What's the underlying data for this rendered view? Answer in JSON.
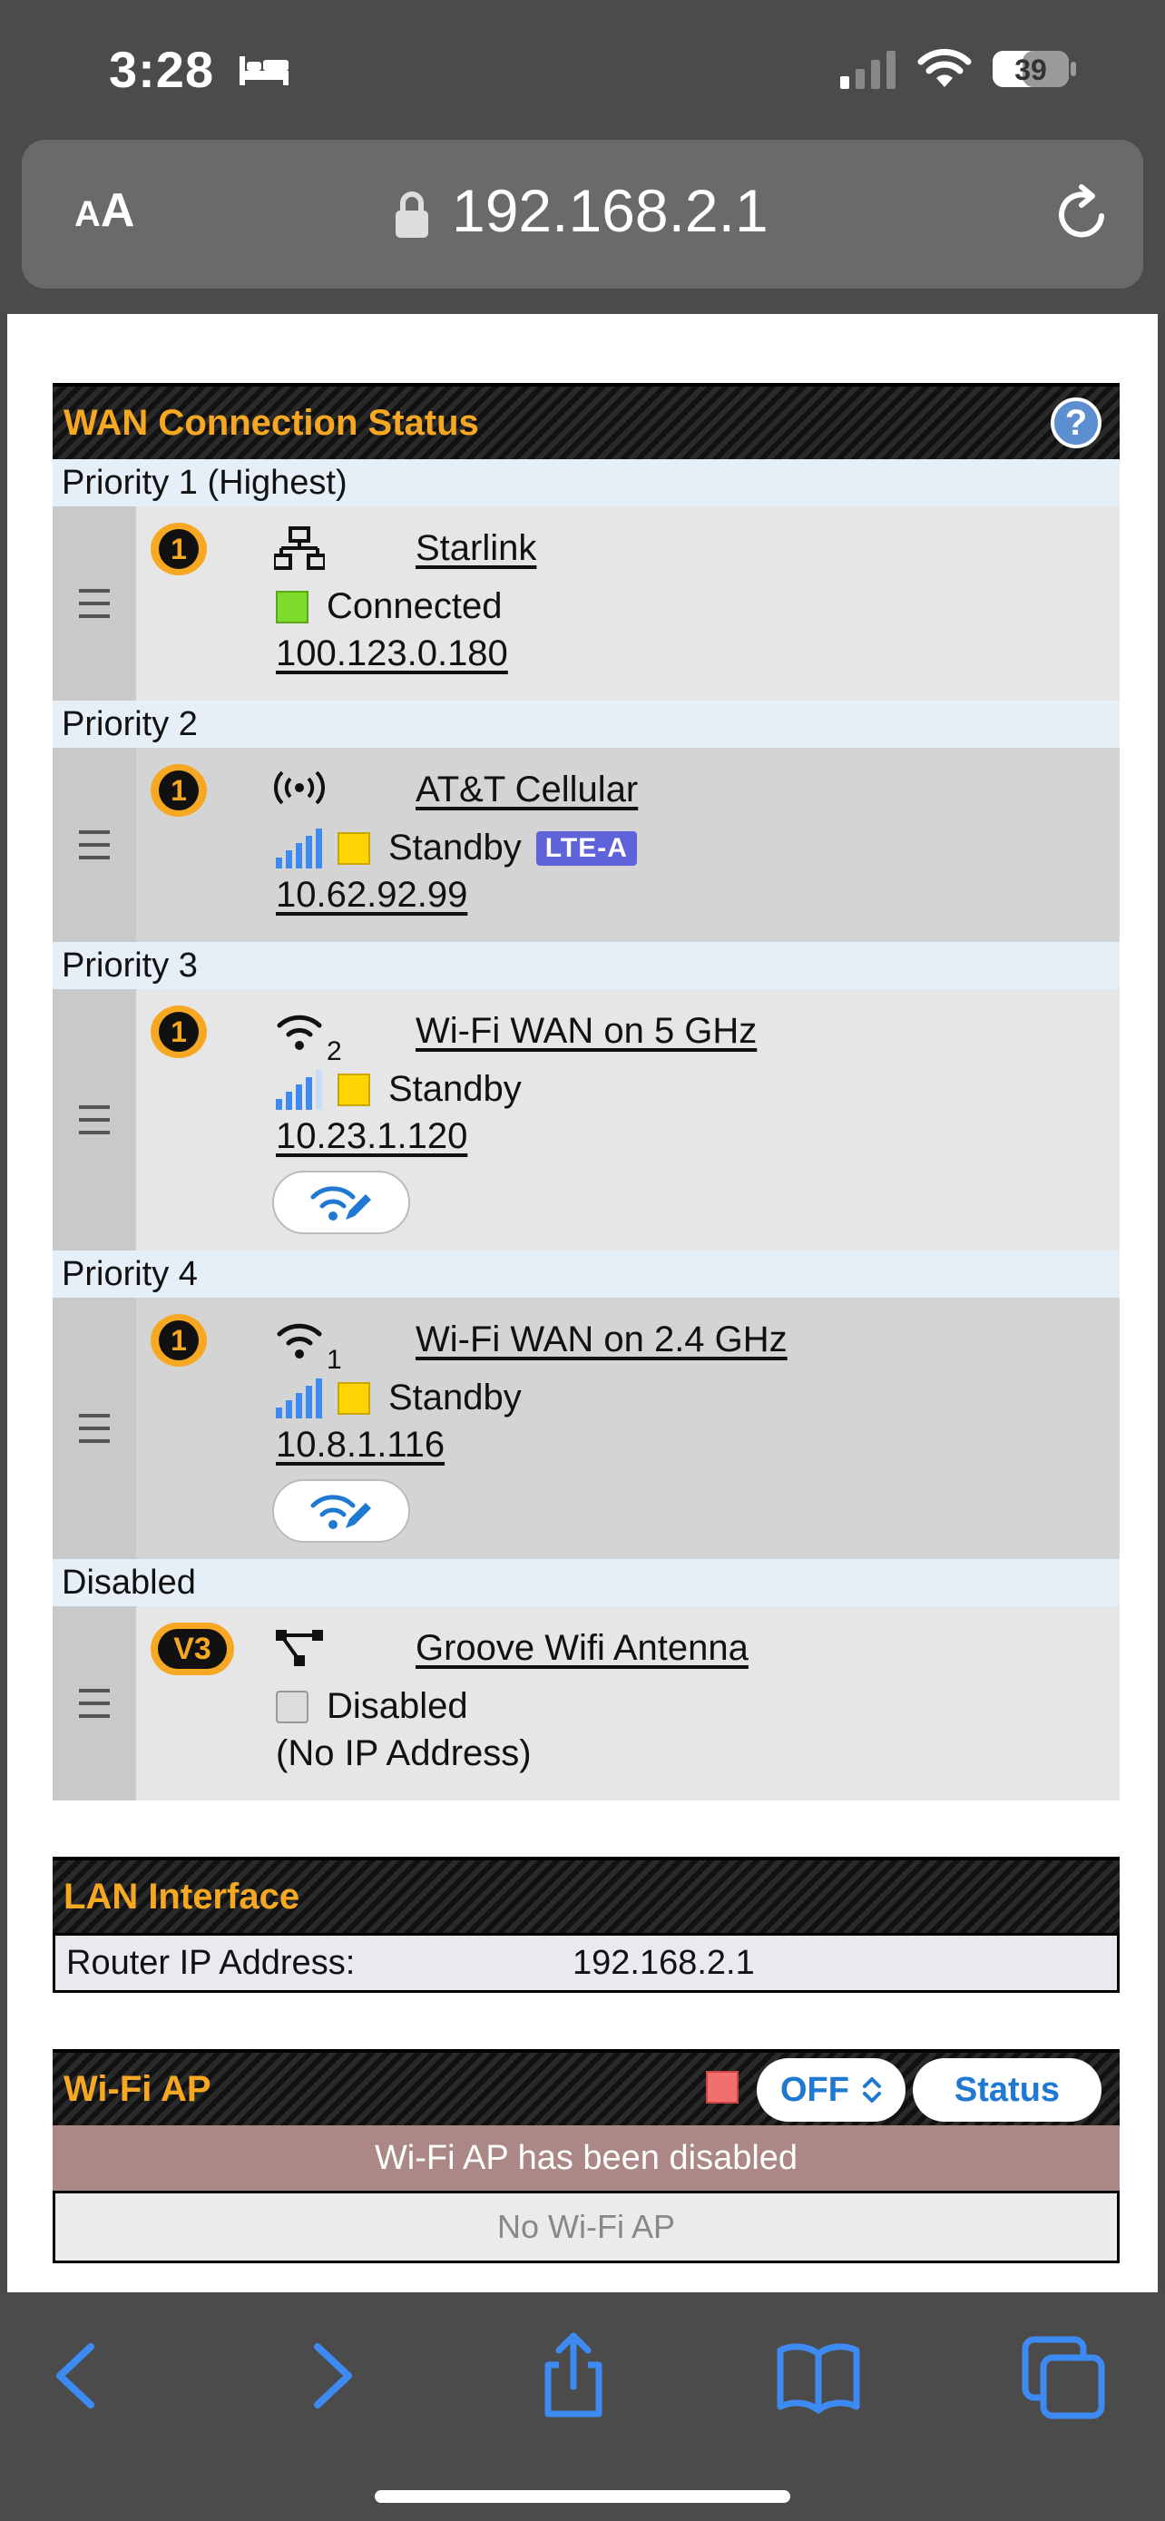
{
  "status_bar": {
    "time": "3:28",
    "battery": "39"
  },
  "browser": {
    "text_size_label_a": "A",
    "text_size_label_b": "A",
    "url": "192.168.2.1"
  },
  "wan": {
    "title": "WAN Connection Status",
    "help": "?",
    "groups": [
      {
        "priority": "Priority 1 (Highest)",
        "badge": "1",
        "name": "Starlink",
        "sub": "",
        "status": "Connected",
        "status_color": "#7ddc2a",
        "ip": "100.123.0.180",
        "icon": "ethernet-icon"
      },
      {
        "priority": "Priority 2",
        "badge": "1",
        "name": "AT&T Cellular",
        "sub": "",
        "status": "Standby",
        "status_color": "#ffd400",
        "tag": "LTE-A",
        "ip": "10.62.92.99",
        "icon": "cellular-icon"
      },
      {
        "priority": "Priority 3",
        "badge": "1",
        "name": "Wi-Fi WAN on 5 GHz",
        "sub": "2",
        "status": "Standby",
        "status_color": "#ffd400",
        "ip": "10.23.1.120",
        "icon": "wifi-icon"
      },
      {
        "priority": "Priority 4",
        "badge": "1",
        "name": "Wi-Fi WAN on 2.4 GHz",
        "sub": "1",
        "status": "Standby",
        "status_color": "#ffd400",
        "ip": "10.8.1.116",
        "icon": "wifi-icon"
      },
      {
        "priority": "Disabled",
        "badge": "V3",
        "name": "Groove Wifi Antenna",
        "sub": "",
        "status": "Disabled",
        "status_color": "#dcdcdc",
        "ip": "(No IP Address)",
        "icon": "network-icon"
      }
    ]
  },
  "lan": {
    "title": "LAN Interface",
    "label": "Router IP Address:",
    "value": "192.168.2.1"
  },
  "wifi_ap": {
    "title": "Wi-Fi AP",
    "select_value": "OFF",
    "status_button": "Status",
    "message": "Wi-Fi AP has been disabled",
    "empty": "No Wi-Fi AP"
  },
  "colors": {
    "accent": "#f6a823",
    "link_blue": "#1f78d1",
    "ios_blue": "#3d8bf2"
  }
}
